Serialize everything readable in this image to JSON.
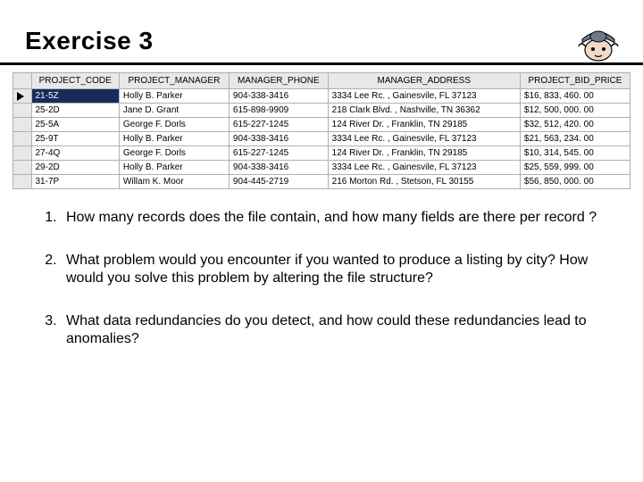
{
  "title": "Exercise 3",
  "table": {
    "headers": [
      "PROJECT_CODE",
      "PROJECT_MANAGER",
      "MANAGER_PHONE",
      "MANAGER_ADDRESS",
      "PROJECT_BID_PRICE"
    ],
    "rows": [
      {
        "code": "21-5Z",
        "manager": "Holly B. Parker",
        "phone": "904-338-3416",
        "address": "3334 Lee Rc. , Gainesvile, FL  37123",
        "price": "$16, 833, 460. 00",
        "selected": true
      },
      {
        "code": "25-2D",
        "manager": "Jane D. Grant",
        "phone": "615-898-9909",
        "address": "218 Clark Blvd. , Nashville, TN  36362",
        "price": "$12, 500, 000. 00"
      },
      {
        "code": "25-5A",
        "manager": "George F. Dorls",
        "phone": "615-227-1245",
        "address": "124 River Dr. , Franklin, TN  29185",
        "price": "$32, 512, 420. 00"
      },
      {
        "code": "25-9T",
        "manager": "Holly B. Parker",
        "phone": "904-338-3416",
        "address": "3334 Lee Rc. , Gainesvile, FL  37123",
        "price": "$21, 563, 234. 00"
      },
      {
        "code": "27-4Q",
        "manager": "George F. Dorls",
        "phone": "615-227-1245",
        "address": "124 River Dr. , Franklin, TN  29185",
        "price": "$10, 314, 545. 00"
      },
      {
        "code": "29-2D",
        "manager": "Holly B. Parker",
        "phone": "904-338-3416",
        "address": "3334 Lee Rc. , Gainesvile, FL  37123",
        "price": "$25, 559, 999. 00"
      },
      {
        "code": "31-7P",
        "manager": "Willam K. Moor",
        "phone": "904-445-2719",
        "address": "216 Morton Rd. , Stetson, FL  30155",
        "price": "$56, 850, 000. 00"
      }
    ]
  },
  "questions": [
    "How many records does the file contain, and how many fields are there per record ?",
    "What problem would you encounter if you wanted to produce a listing by city? How would you solve this problem by altering the file structure?",
    "What data redundancies do you detect, and how could these redundancies lead to anomalies?"
  ],
  "chart_data": {
    "type": "table",
    "title": "Exercise 3 project records",
    "columns": [
      "PROJECT_CODE",
      "PROJECT_MANAGER",
      "MANAGER_PHONE",
      "MANAGER_ADDRESS",
      "PROJECT_BID_PRICE"
    ],
    "rows": [
      [
        "21-5Z",
        "Holly B. Parker",
        "904-338-3416",
        "3334 Lee Rc. , Gainesvile, FL 37123",
        16833460.0
      ],
      [
        "25-2D",
        "Jane D. Grant",
        "615-898-9909",
        "218 Clark Blvd. , Nashville, TN 36362",
        12500000.0
      ],
      [
        "25-5A",
        "George F. Dorls",
        "615-227-1245",
        "124 River Dr. , Franklin, TN 29185",
        32512420.0
      ],
      [
        "25-9T",
        "Holly B. Parker",
        "904-338-3416",
        "3334 Lee Rc. , Gainesvile, FL 37123",
        21563234.0
      ],
      [
        "27-4Q",
        "George F. Dorls",
        "615-227-1245",
        "124 River Dr. , Franklin, TN 29185",
        10314545.0
      ],
      [
        "29-2D",
        "Holly B. Parker",
        "904-338-3416",
        "3334 Lee Rc. , Gainesvile, FL 37123",
        25559999.0
      ],
      [
        "31-7P",
        "Willam K. Moor",
        "904-445-2719",
        "216 Morton Rd. , Stetson, FL 30155",
        56850000.0
      ]
    ]
  }
}
